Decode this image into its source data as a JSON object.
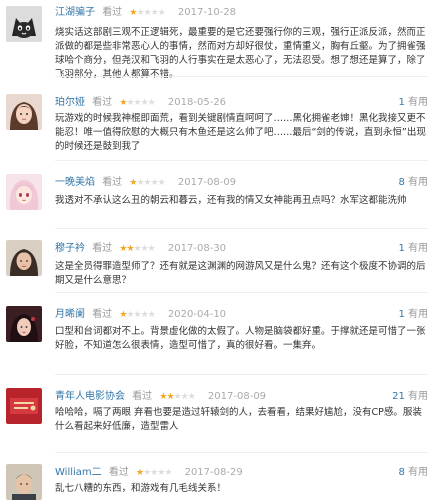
{
  "useful_suffix": "有用",
  "badge_label": "看过",
  "colors": {
    "username": "#3377aa",
    "star_on": "#f5a623",
    "star_off": "#dddddd"
  },
  "reviews": [
    {
      "user": "江湖骗子",
      "rating": 1,
      "date": "2017-10-28",
      "useful": "",
      "text": "烧实话这部剧三观不正逻辑死，最重要的是它还要强行你的三观，强行正派反派，然而正派做的都是些非常恶心人的事情，然而对方却好很仗，重情重义，胸有丘壑。为了拥雀强球哈个商分，但尧汉和飞羽的人行事实在是太恶心了，无法忍受。想了想还是算了，除了飞羽部分，其他人都算不错。"
    },
    {
      "user": "珀尔娅",
      "rating": 1,
      "date": "2018-05-26",
      "useful": "1",
      "text": "玩游戏的时候我神棍即面荒，看到关键剧情直呵呵了……黑化拥雀老婶！黑化我接又更不能忍！唯一值得欣慰的大概只有木鱼还是这么帅了吧……最后“剑的传说，直到永恒”出现的时候还是鼓到我了"
    },
    {
      "user": "一晚美焰",
      "rating": 1,
      "date": "2017-08-09",
      "useful": "8",
      "text": "我透对不承认这么丑的朝云和暮云，还有我的情又女神能再丑点吗？水军这都能洗帅"
    },
    {
      "user": "穆子衿",
      "rating": 2,
      "date": "2017-08-30",
      "useful": "1",
      "text": "这是全员得罪造型师了？还有就是这渊渊的网游风又是什么鬼？还有这个极度不协调的后期又是什么意思？"
    },
    {
      "user": "月晞阑",
      "rating": 1,
      "date": "2020-04-10",
      "useful": "1",
      "text": "口型和台词都对不上。背景虚化做的太假了。人物是脑袋都好重。于撑就还是可惜了一张好脸，不知道怎么很表情，造型可惜了，真的很好看。一集弃。"
    },
    {
      "user": "青年人电影协会",
      "rating": 2,
      "date": "2017-08-09",
      "useful": "21",
      "text": "哈哈哈，嗝了两眼 弃看也要是造过轩辕剑的人，去看看，结果好尴尬，没有CP感。服装什么看起来好低廉，造型雷人"
    },
    {
      "user": "William二",
      "rating": 1,
      "date": "2017-08-29",
      "useful": "8",
      "text": "乱七八糟的东西，和游戏有几毛线关系！"
    }
  ]
}
